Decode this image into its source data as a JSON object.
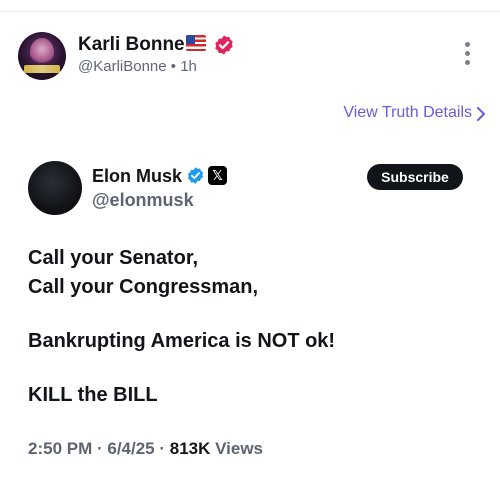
{
  "truth_post": {
    "author_name": "Karli Bonne’",
    "author_handle": "@KarliBonne",
    "separator": "•",
    "time_ago": "1h",
    "view_details_label": "View Truth Details"
  },
  "embedded_post": {
    "author_name": "Elon Musk",
    "author_handle": "@elonmusk",
    "subscribe_label": "Subscribe",
    "lines": [
      "Call your Senator,",
      "Call your Congressman,",
      "Bankrupting America is NOT ok!",
      "KILL the BILL"
    ],
    "time": "2:50 PM",
    "date": "6/4/25",
    "views_count": "813K",
    "views_label": "Views"
  },
  "icons": {
    "flag": "us-flag-icon",
    "truth_verified": "red-verified-badge-icon",
    "x_verified": "blue-verified-badge-icon",
    "x_platform": "x-logo-icon",
    "more": "more-vertical-icon",
    "chevron": "chevron-right-icon"
  },
  "colors": {
    "accent_link": "#6b5bd6",
    "verified_red": "#e0245e",
    "verified_blue": "#1d9bf0",
    "text_primary": "#111418",
    "text_secondary": "#5d6570"
  }
}
